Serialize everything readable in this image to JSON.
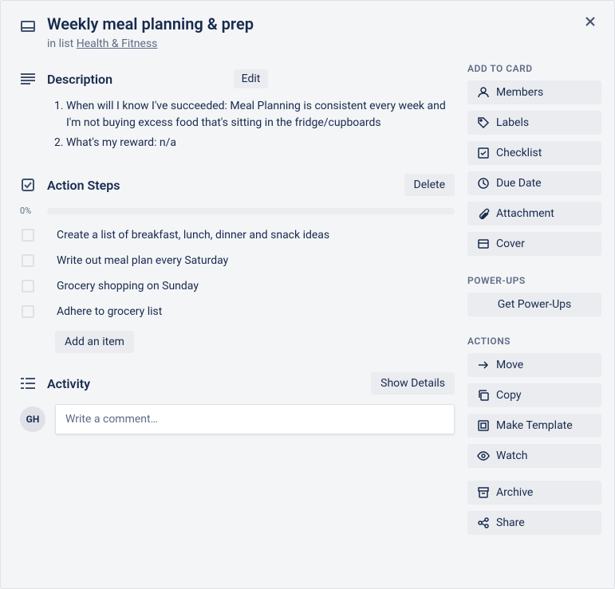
{
  "header": {
    "title": "Weekly meal planning & prep",
    "listPrefix": "in list ",
    "listName": "Health & Fitness"
  },
  "description": {
    "title": "Description",
    "editLabel": "Edit",
    "items": [
      "When will I know I've succeeded: Meal Planning is consistent every week and I'm not buying excess food that's sitting in the fridge/cupboards",
      "What's my reward: n/a"
    ]
  },
  "actionSteps": {
    "title": "Action Steps",
    "deleteLabel": "Delete",
    "progress": "0%",
    "items": [
      "Create a list of breakfast, lunch, dinner and snack ideas",
      "Write out meal plan every Saturday",
      "Grocery shopping on Sunday",
      "Adhere to grocery list"
    ],
    "addItemLabel": "Add an item"
  },
  "activity": {
    "title": "Activity",
    "showDetailsLabel": "Show Details",
    "avatarInitials": "GH",
    "commentPlaceholder": "Write a comment…"
  },
  "sidebar": {
    "addToCard": {
      "title": "ADD TO CARD",
      "members": "Members",
      "labels": "Labels",
      "checklist": "Checklist",
      "dueDate": "Due Date",
      "attachment": "Attachment",
      "cover": "Cover"
    },
    "powerUps": {
      "title": "POWER-UPS",
      "getPowerUps": "Get Power-Ups"
    },
    "actions": {
      "title": "ACTIONS",
      "move": "Move",
      "copy": "Copy",
      "makeTemplate": "Make Template",
      "watch": "Watch",
      "archive": "Archive",
      "share": "Share"
    }
  }
}
